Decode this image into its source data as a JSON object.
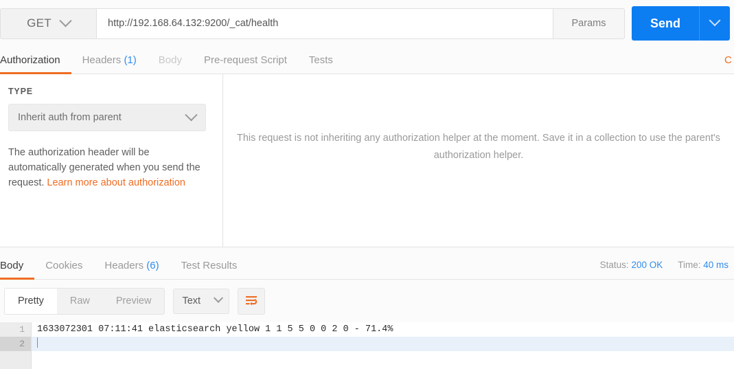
{
  "request_bar": {
    "method": "GET",
    "url_value": "http://192.168.64.132:9200/_cat/health",
    "url_placeholder": "Enter request URL",
    "params_label": "Params",
    "send_label": "Send"
  },
  "request_tabs": {
    "items": [
      {
        "label": "Authorization",
        "count": "",
        "state": "active"
      },
      {
        "label": "Headers",
        "count": "(1)",
        "state": "normal"
      },
      {
        "label": "Body",
        "count": "",
        "state": "disabled"
      },
      {
        "label": "Pre-request Script",
        "count": "",
        "state": "normal"
      },
      {
        "label": "Tests",
        "count": "",
        "state": "normal"
      }
    ],
    "right_cut_label": "C"
  },
  "authorization": {
    "type_label": "TYPE",
    "type_value": "Inherit auth from parent",
    "help_text": "The authorization header will be automatically generated when you send the request. ",
    "help_link": "Learn more about authorization",
    "right_message": "This request is not inheriting any authorization helper at the moment. Save it in a collection to use the parent's authorization helper."
  },
  "response_tabs": {
    "items": [
      {
        "label": "Body",
        "count": "",
        "state": "active"
      },
      {
        "label": "Cookies",
        "count": "",
        "state": "normal"
      },
      {
        "label": "Headers",
        "count": "(6)",
        "state": "normal"
      },
      {
        "label": "Test Results",
        "count": "",
        "state": "normal"
      }
    ],
    "status_label": "Status:",
    "status_value": "200 OK",
    "time_label": "Time:",
    "time_value": "40 ms"
  },
  "viewer": {
    "modes": [
      {
        "label": "Pretty",
        "state": "active"
      },
      {
        "label": "Raw",
        "state": "normal"
      },
      {
        "label": "Preview",
        "state": "normal"
      }
    ],
    "format_value": "Text",
    "wrap_icon": "word-wrap-icon"
  },
  "response_body": {
    "lines": [
      {
        "number": "1",
        "text": "1633072301 07:11:41 elasticsearch yellow 1 1 5 5 0 0 2 0 - 71.4%",
        "active": false
      },
      {
        "number": "2",
        "text": "",
        "active": true
      }
    ]
  },
  "colors": {
    "accent_orange": "#ef6c23",
    "accent_blue": "#0d7df2",
    "link_blue": "#2f8ced"
  }
}
